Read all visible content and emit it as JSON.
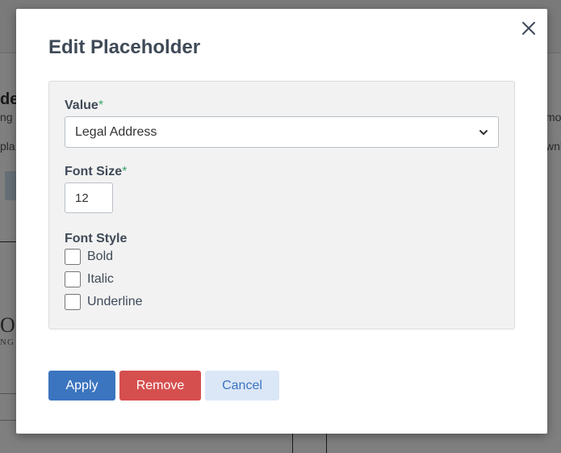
{
  "background": {
    "heading_fragment": "de",
    "sub1_fragment": "ng",
    "sub2_fragment": "pla",
    "right1_fragment": "mo",
    "right2_fragment": "wnl",
    "logo_fragment": "OS",
    "logo_sub_fragment": "NG"
  },
  "modal": {
    "title": "Edit Placeholder",
    "close_icon": "close-icon",
    "fields": {
      "value": {
        "label": "Value",
        "required_mark": "*",
        "selected": "Legal Address"
      },
      "font_size": {
        "label": "Font Size",
        "required_mark": "*",
        "value": "12"
      },
      "font_style": {
        "label": "Font Style",
        "options": [
          {
            "label": "Bold",
            "checked": false
          },
          {
            "label": "Italic",
            "checked": false
          },
          {
            "label": "Underline",
            "checked": false
          }
        ]
      }
    },
    "buttons": {
      "apply": "Apply",
      "remove": "Remove",
      "cancel": "Cancel"
    }
  },
  "colors": {
    "primary": "#3b74bf",
    "danger": "#d64f4f",
    "secondary_bg": "#dbe7f6",
    "required": "#3aa56c",
    "text": "#3f4a57"
  }
}
